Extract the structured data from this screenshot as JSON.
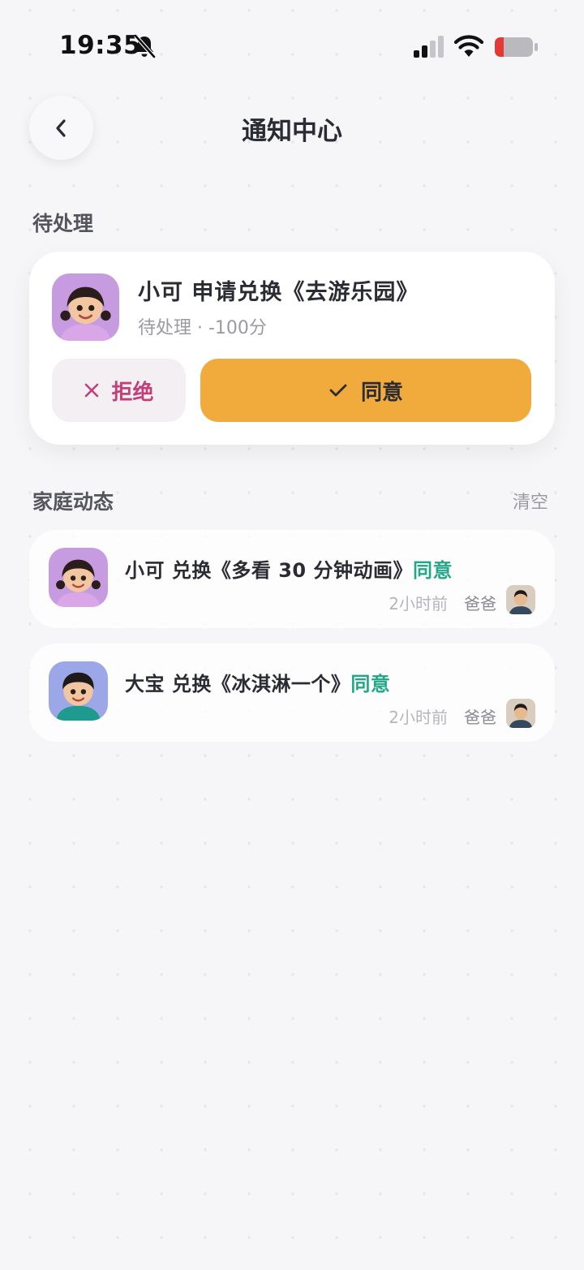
{
  "status_bar": {
    "time": "19:35"
  },
  "header": {
    "title": "通知中心"
  },
  "pending": {
    "section_label": "待处理",
    "request": {
      "title": "小可 申请兑换《去游乐园》",
      "subtitle": "待处理 · -100分",
      "reject_label": "拒绝",
      "approve_label": "同意"
    }
  },
  "feed": {
    "section_label": "家庭动态",
    "clear_label": "清空",
    "items": [
      {
        "text": "小可 兑换《多看 30 分钟动画》",
        "status": "同意",
        "time": "2小时前",
        "actor": "爸爸",
        "avatar": "girl-avatar"
      },
      {
        "text": "大宝 兑换《冰淇淋一个》",
        "status": "同意",
        "time": "2小时前",
        "actor": "爸爸",
        "avatar": "boy-avatar"
      }
    ]
  },
  "colors": {
    "accent_orange": "#f1aa3c",
    "approve_green": "#22a787",
    "reject_pink": "#c2407a",
    "background": "#f6f6f8"
  }
}
